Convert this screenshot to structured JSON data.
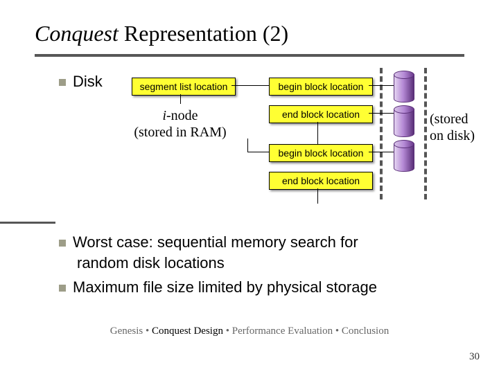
{
  "title": {
    "part1": "Conquest",
    "part2": " Representation (2)"
  },
  "bullets": {
    "disk": "Disk",
    "worst_l1": "Worst case:  sequential memory search for",
    "worst_l2": "random disk locations",
    "maxfs": "Maximum file size limited by physical storage"
  },
  "labels": {
    "segment_list": "segment list location",
    "begin_block1": "begin block location",
    "end_block1": "end block location",
    "begin_block2": "begin block location",
    "end_block2": "end block location",
    "inode_line1_i": "i",
    "inode_line1_rest": "-node",
    "inode_line2": "(stored in RAM)",
    "stored_disk_l1": "(stored",
    "stored_disk_l2": "on disk)"
  },
  "footer": {
    "p1": "Genesis",
    "sep": " • ",
    "p2": "Conquest Design",
    "p3": "Performance Evaluation",
    "p4": "Conclusion"
  },
  "page_number": "30"
}
